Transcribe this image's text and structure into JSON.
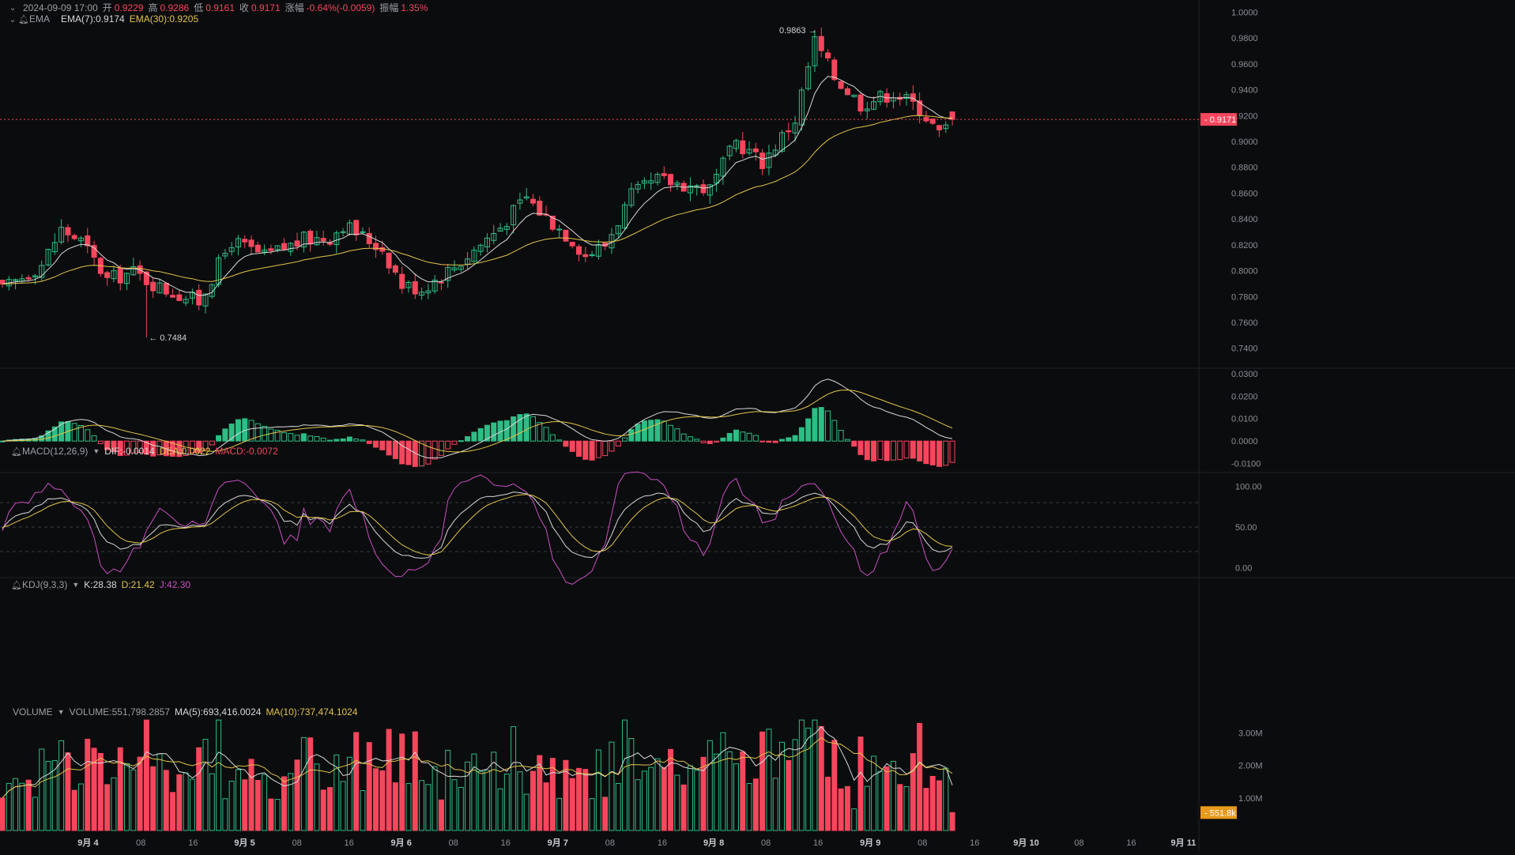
{
  "header": {
    "date": "2024-09-09 17:00",
    "open_label": "开",
    "open": "0.9229",
    "high_label": "高",
    "high": "0.9286",
    "low_label": "低",
    "low": "0.9161",
    "close_label": "收",
    "close": "0.9171",
    "chg_label": "涨幅",
    "chg": "-0.64%(-0.0059)",
    "amp_label": "振幅",
    "amp": "1.35%"
  },
  "ema_legend": {
    "name": "EMA",
    "ema7": "EMA(7):0.9174",
    "ema30": "EMA(30):0.9205"
  },
  "macd_legend": {
    "name": "MACD(12,26,9)",
    "dif": "DIF:-0.0014",
    "dea": "DEA:0.0022",
    "macd": "MACD:-0.0072"
  },
  "kdj_legend": {
    "name": "KDJ(9,3,3)",
    "k": "K:28.38",
    "d": "D:21.42",
    "j": "J:42.30"
  },
  "vol_legend": {
    "name": "VOLUME",
    "volume": "VOLUME:551,798.2857",
    "ma5": "MA(5):693,416.0024",
    "ma10": "MA(10):737,474.1024"
  },
  "colors": {
    "up": "#2ebd85",
    "down": "#f6465d",
    "ema7": "#d9d9d9",
    "ema30": "#e2c44a",
    "kdj_j": "#c94fc1",
    "bg": "#0b0c0e"
  },
  "chart_data": [
    {
      "type": "candlestick",
      "title": "",
      "price_axis": {
        "ticks": [
          "1.0000",
          "0.9800",
          "0.9600",
          "0.9400",
          "0.9200",
          "0.9000",
          "0.8800",
          "0.8600",
          "0.8400",
          "0.8200",
          "0.8000",
          "0.7800",
          "0.7600",
          "0.7400"
        ],
        "min": 0.7245,
        "max": 1.0095
      },
      "time_axis": [
        "9月 4",
        "08",
        "16",
        "9月 5",
        "08",
        "16",
        "9月 6",
        "08",
        "16",
        "9月 7",
        "08",
        "16",
        "9月 8",
        "08",
        "16",
        "9月 9",
        "08",
        "16",
        "9月 10",
        "08",
        "16",
        "9月 11"
      ],
      "high_marker": "0.9863",
      "low_marker": "0.7484",
      "last_price": "0.9171",
      "candles_count": 146,
      "first_close": 0.791,
      "last_close": 0.9171
    },
    {
      "type": "line",
      "title": "MACD",
      "ticks": [
        "0.0300",
        "0.0200",
        "0.0100",
        "0.0000",
        "-0.0100"
      ],
      "range": [
        -0.014,
        0.031
      ]
    },
    {
      "type": "line",
      "title": "KDJ",
      "ticks": [
        "100.00",
        "50.00",
        "0.00"
      ],
      "range": [
        -12,
        113
      ]
    },
    {
      "type": "bar",
      "title": "VOLUME",
      "ticks": [
        "3.00M",
        "2.00M",
        "1.00M"
      ],
      "range": [
        0,
        3.55
      ],
      "last_volume": "551.8k"
    }
  ]
}
